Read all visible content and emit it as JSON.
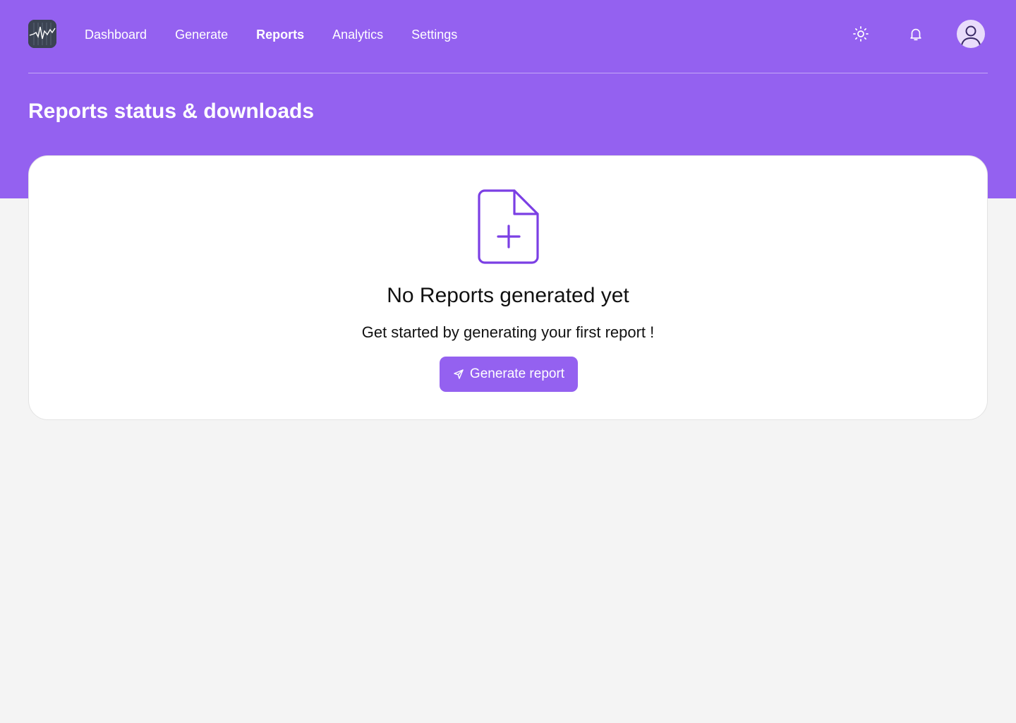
{
  "nav": {
    "items": [
      {
        "label": "Dashboard",
        "active": false
      },
      {
        "label": "Generate",
        "active": false
      },
      {
        "label": "Reports",
        "active": true
      },
      {
        "label": "Analytics",
        "active": false
      },
      {
        "label": "Settings",
        "active": false
      }
    ]
  },
  "header": {
    "icons": [
      "sun-icon",
      "bell-icon",
      "user-avatar-icon"
    ]
  },
  "page": {
    "title": "Reports status & downloads"
  },
  "empty_state": {
    "icon": "file-plus-icon",
    "title": "No Reports generated yet",
    "subtitle": "Get started by generating your first report !",
    "button_label": "Generate report",
    "button_icon": "send-icon"
  },
  "colors": {
    "brand": "#9461f0",
    "accent_dark": "#7b3fe4",
    "background": "#f4f4f4",
    "card": "#ffffff"
  }
}
